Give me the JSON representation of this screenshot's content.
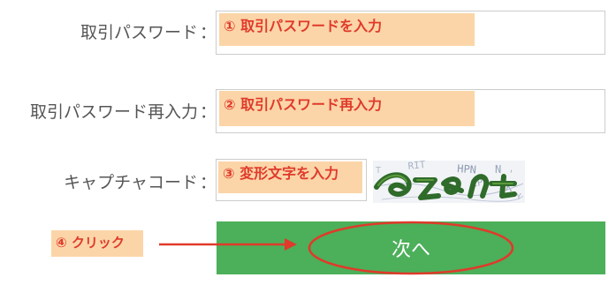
{
  "form": {
    "password": {
      "label": "取引パスワード",
      "colon": "：",
      "hint": "① 取引パスワードを入力",
      "value": ""
    },
    "password_confirm": {
      "label": "取引パスワード再入力",
      "colon": "：",
      "hint": "② 取引パスワード再入力",
      "value": ""
    },
    "captcha": {
      "label": "キャプチャコード",
      "colon": "：",
      "hint": "③ 変形文字を入力",
      "value": ""
    }
  },
  "next_button": {
    "label": "次へ"
  },
  "annotation": {
    "click_hint": "④ クリック"
  },
  "colors": {
    "button_green": "#4caf5a",
    "annotation_red": "#e03a2a",
    "annotation_bg": "#fbd5a8",
    "label_gray": "#555555"
  },
  "icons": [
    "arrow-right-icon"
  ]
}
